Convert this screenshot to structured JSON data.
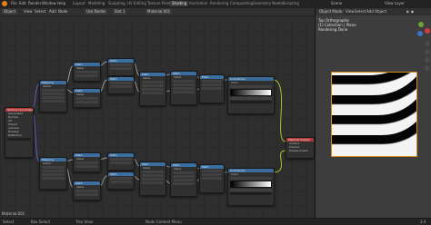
{
  "topbar": {
    "menus": [
      "File",
      "Edit",
      "Render",
      "Window",
      "Help"
    ],
    "workspace_tabs": [
      "Layout",
      "Modeling",
      "Sculpting",
      "UV Editing",
      "Texture Paint",
      "Shading",
      "Animation",
      "Rendering",
      "Compositing",
      "Geometry Nodes",
      "Scripting"
    ],
    "active_tab": "Shading",
    "scene_label": "Scene",
    "view_layer_label": "View Layer"
  },
  "node_editor": {
    "header": {
      "editor_type": "Object",
      "menus": [
        "View",
        "Select",
        "Add",
        "Node"
      ],
      "use_nodes_label": "Use Nodes",
      "slot_label": "Slot 1",
      "material_name": "Material.001"
    },
    "footer_label": "Material.001",
    "nodes": {
      "texcoord_title": "Texture Coordinate",
      "mapping_title": "Mapping",
      "math_title": "Math",
      "output_title": "Material Output",
      "ramp_title": "ColorRamp",
      "output_rows": [
        "Surface",
        "Volume",
        "Displacement"
      ],
      "texcoord_rows": [
        "Generated",
        "Normal",
        "UV",
        "Object",
        "Camera",
        "Window",
        "Reflection"
      ],
      "node_rows": [
        "Value",
        "Vector",
        "Color",
        "Fac"
      ]
    }
  },
  "viewport": {
    "mode_label": "Object Mode",
    "menus": [
      "View",
      "Select",
      "Add",
      "Object"
    ],
    "info_lines": [
      "Top Orthographic",
      "(1) Collection | Plane",
      "Rendering Done"
    ]
  },
  "statusbar": {
    "items": [
      "Select",
      "Box Select",
      "Pan View",
      "Node Context Menu"
    ],
    "version": "3.4"
  },
  "colors": {
    "accent": "#e87d0d",
    "texture_header": "#3b6b99",
    "output_header": "#b23a3a",
    "selection_outline": "#d88a1a"
  }
}
